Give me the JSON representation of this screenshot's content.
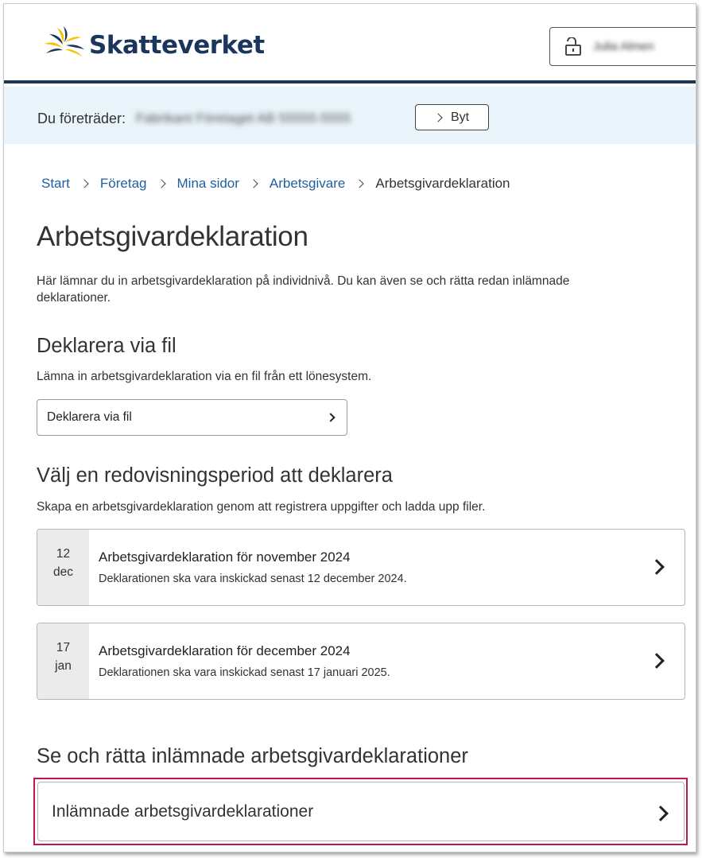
{
  "header": {
    "logo_text": "Skatteverket",
    "login_user": "Julia Almen"
  },
  "representing": {
    "label": "Du företräder:",
    "value": "Fabrikant Företaget AB 55555-5555",
    "switch_label": "Byt"
  },
  "breadcrumb": {
    "items": [
      "Start",
      "Företag",
      "Mina sidor",
      "Arbetsgivare"
    ],
    "current": "Arbetsgivardeklaration"
  },
  "page": {
    "title": "Arbetsgivardeklaration",
    "intro": "Här lämnar du in arbetsgivardeklaration på individnivå. Du kan även se och rätta redan inlämnade deklarationer."
  },
  "file_section": {
    "heading": "Deklarera via fil",
    "description": "Lämna in arbetsgivardeklaration via en fil från ett lönesystem.",
    "button_label": "Deklarera via fil"
  },
  "period_section": {
    "heading": "Välj en redovisningsperiod att deklarera",
    "description": "Skapa en arbetsgivardeklaration genom att registrera uppgifter och ladda upp filer.",
    "periods": [
      {
        "day": "12",
        "month": "dec",
        "title": "Arbetsgivardeklaration för november 2024",
        "deadline": "Deklarationen ska vara inskickad senast 12 december 2024."
      },
      {
        "day": "17",
        "month": "jan",
        "title": "Arbetsgivardeklaration för december 2024",
        "deadline": "Deklarationen ska vara inskickad senast 17 januari 2025."
      }
    ]
  },
  "submitted_section": {
    "heading": "Se och rätta inlämnade arbetsgivardeklarationer",
    "button_label": "Inlämnade arbetsgivardeklarationer"
  },
  "colors": {
    "brand_navy": "#1b365d",
    "brand_yellow": "#f5c400",
    "link_blue": "#1f5fa0",
    "rep_bar_bg": "#e9f4fb",
    "highlight": "#c1184a"
  }
}
